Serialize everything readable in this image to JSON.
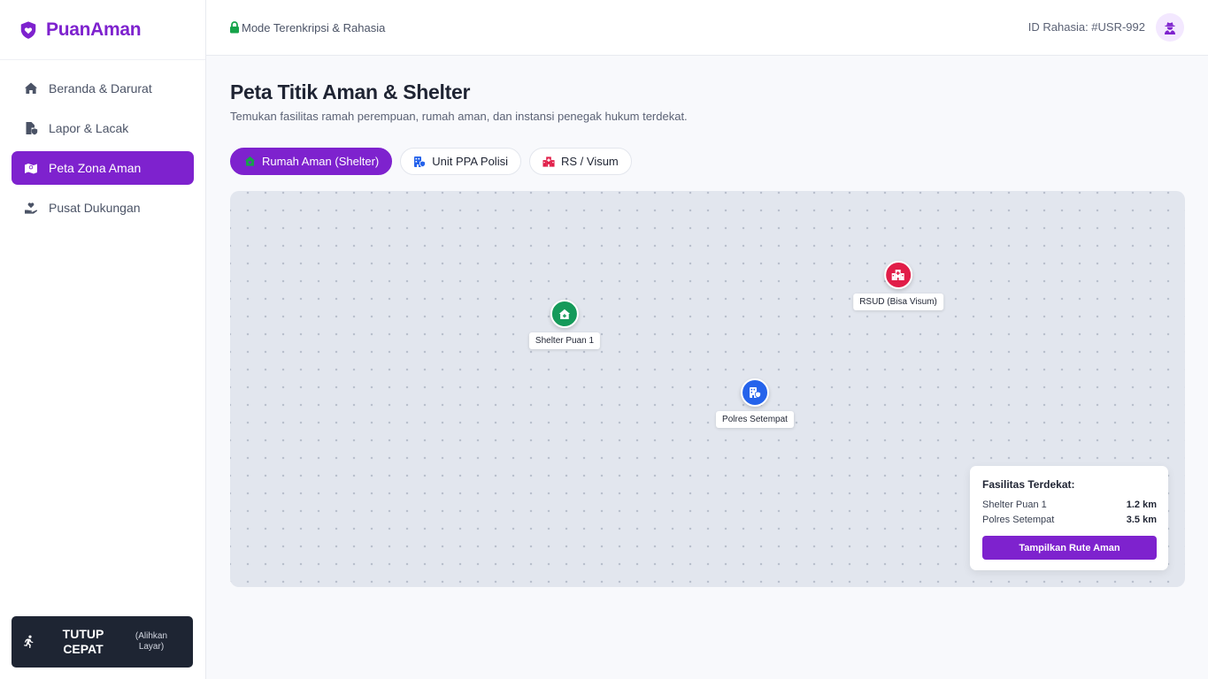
{
  "app": {
    "name": "PuanAman"
  },
  "sidebar": {
    "items": [
      {
        "label": "Beranda & Darurat",
        "icon": "home-icon",
        "active": false
      },
      {
        "label": "Lapor & Lacak",
        "icon": "file-shield-icon",
        "active": false
      },
      {
        "label": "Peta Zona Aman",
        "icon": "map-icon",
        "active": true
      },
      {
        "label": "Pusat Dukungan",
        "icon": "hand-holding-heart-icon",
        "active": false
      }
    ],
    "quick_exit": {
      "title": "TUTUP CEPAT",
      "subtitle": "(Alihkan Layar)",
      "icon": "running-person-icon"
    }
  },
  "topbar": {
    "encryption_label": "Mode Terenkripsi & Rahasia",
    "secret_id": "ID Rahasia: #USR-992",
    "avatar_icon": "user-secret-icon"
  },
  "page": {
    "title": "Peta Titik Aman & Shelter",
    "subtitle": "Temukan fasilitas ramah perempuan, rumah aman, dan instansi penegak hukum terdekat."
  },
  "filters": [
    {
      "label": "Rumah Aman (Shelter)",
      "icon": "house-icon",
      "active": true
    },
    {
      "label": "Unit PPA Polisi",
      "icon": "police-building-icon",
      "active": false
    },
    {
      "label": "RS / Visum",
      "icon": "hospital-icon",
      "active": false
    }
  ],
  "map": {
    "markers": [
      {
        "label": "Shelter Puan 1",
        "type": "shelter",
        "color": "#16a34a"
      },
      {
        "label": "RSUD (Bisa Visum)",
        "type": "hospital",
        "color": "#e11d48"
      },
      {
        "label": "Polres Setempat",
        "type": "police",
        "color": "#2563eb"
      }
    ],
    "nearest": {
      "title": "Fasilitas Terdekat:",
      "rows": [
        {
          "name": "Shelter Puan 1",
          "distance": "1.2 km"
        },
        {
          "name": "Polres Setempat",
          "distance": "3.5 km"
        }
      ],
      "button_label": "Tampilkan Rute Aman"
    }
  },
  "colors": {
    "accent": "#7e22ce",
    "dark": "#1e2533",
    "map_bg": "#e2e6ee"
  }
}
